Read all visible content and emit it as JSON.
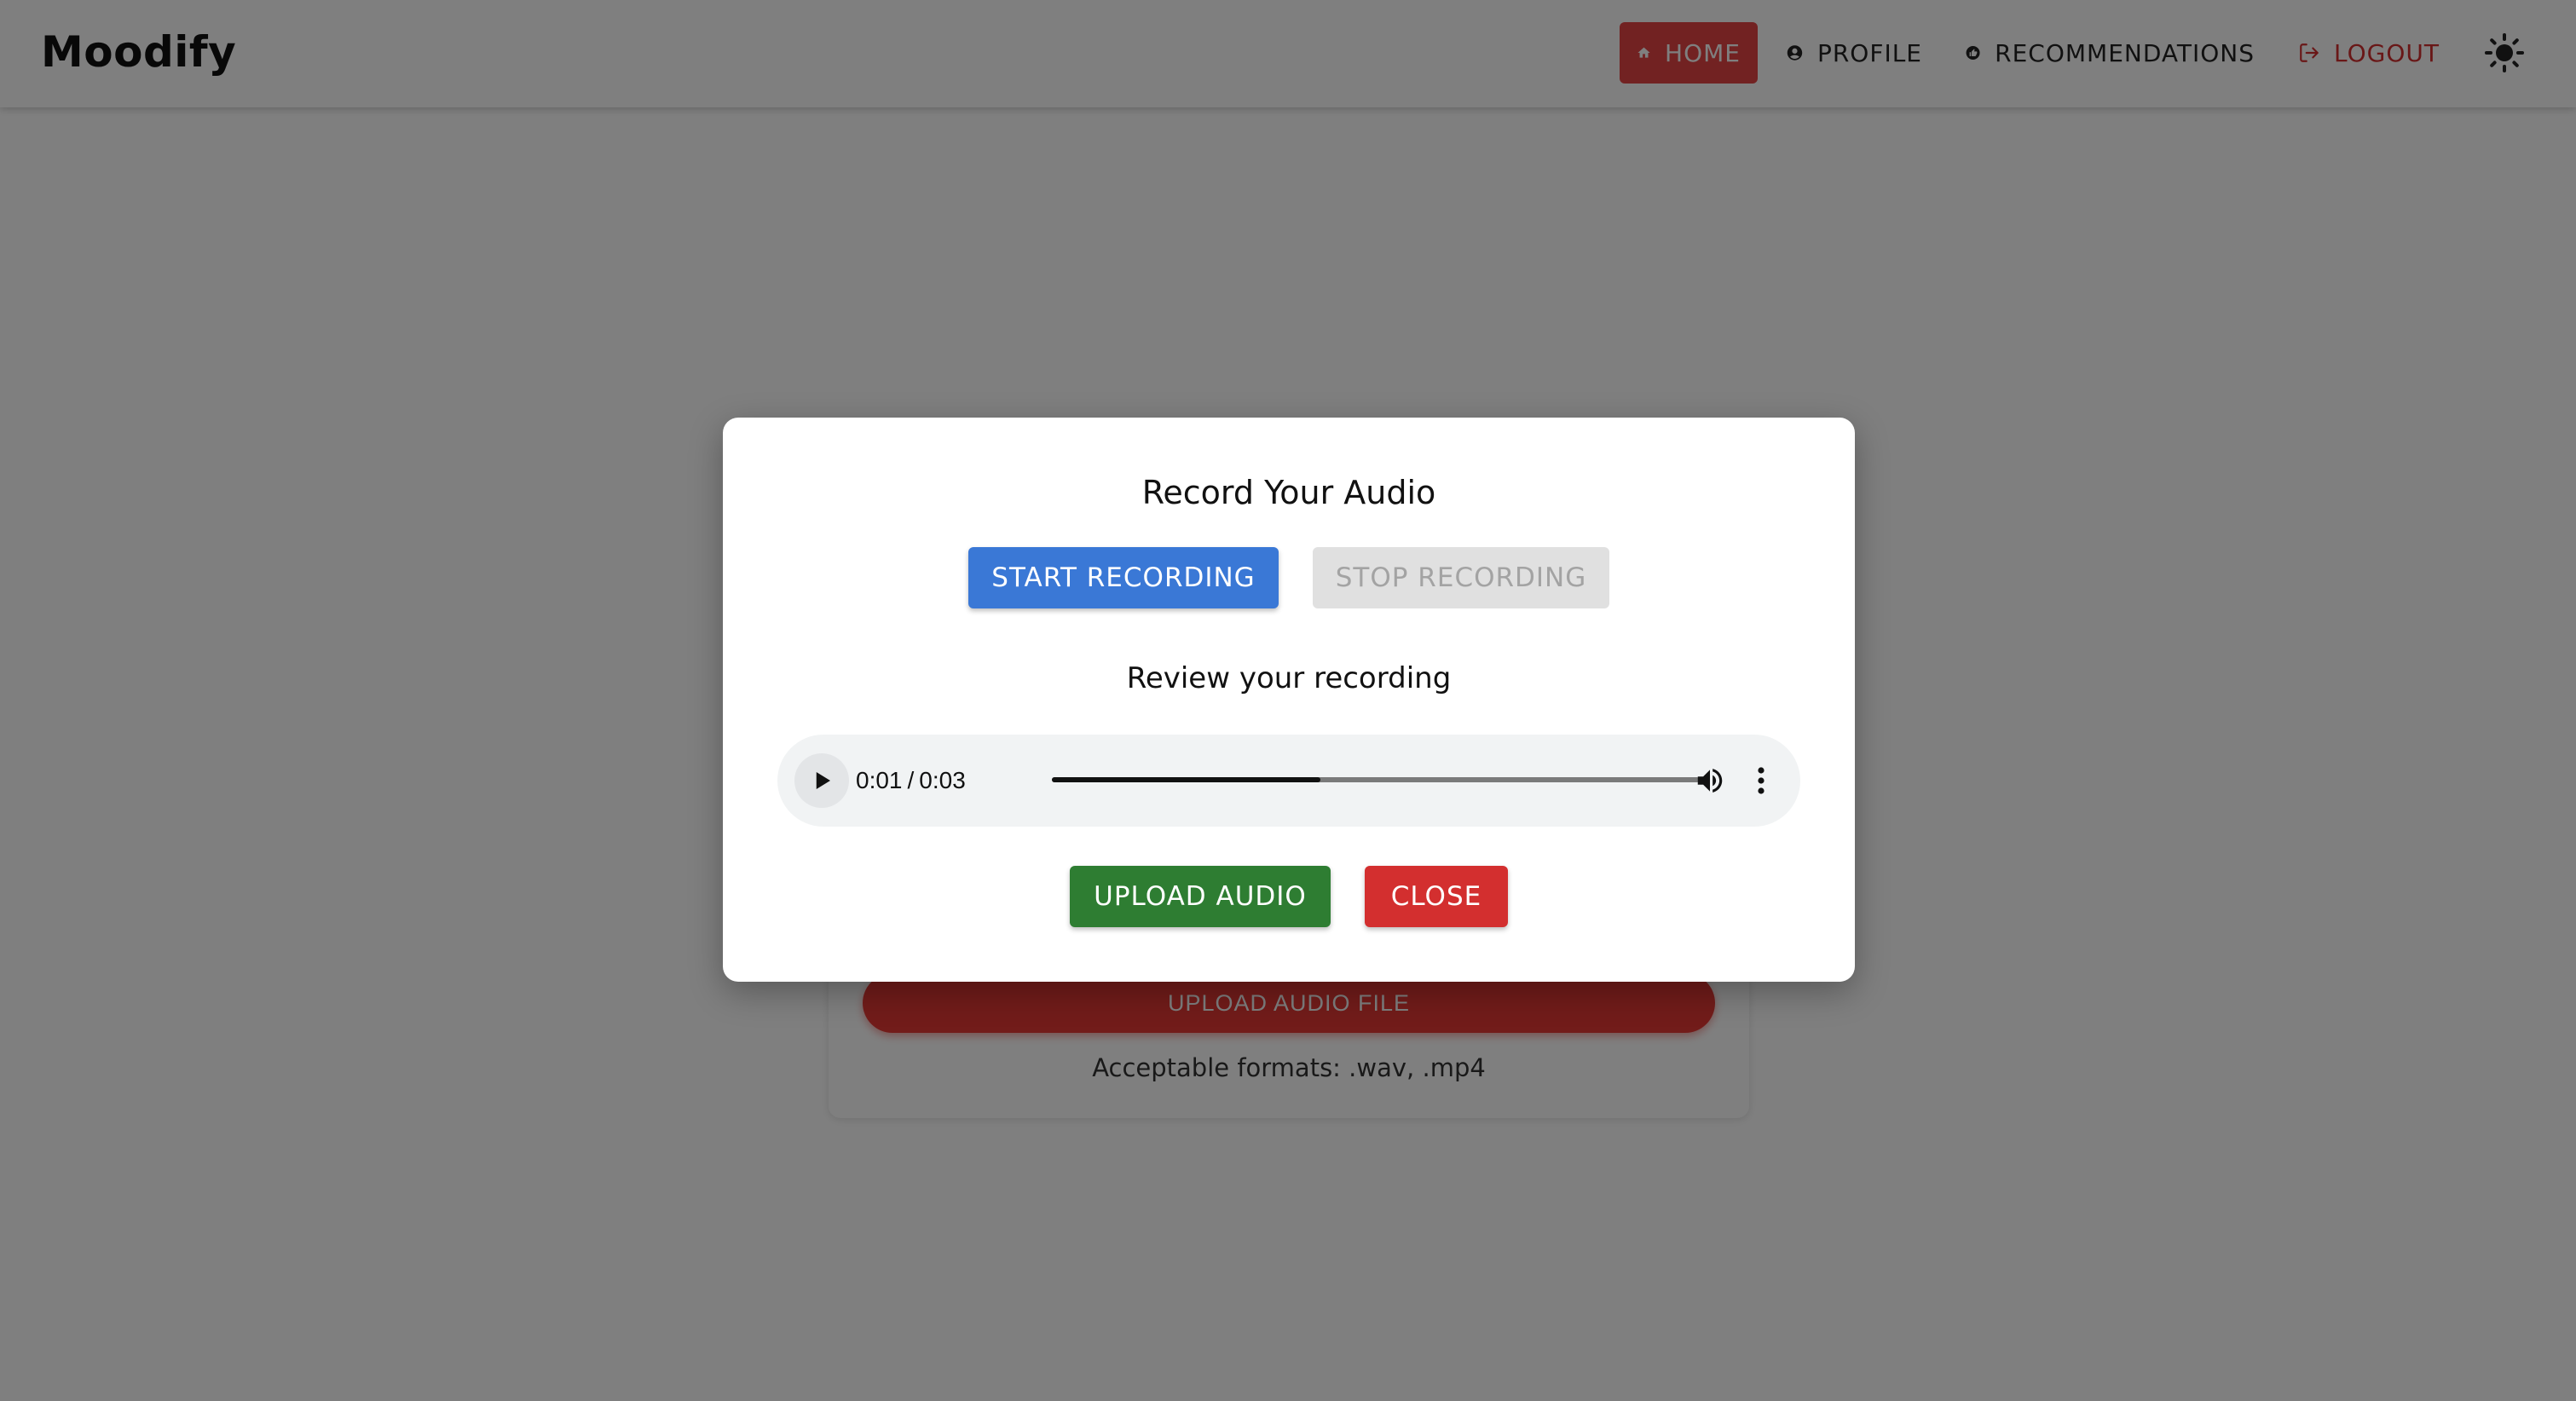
{
  "app": {
    "title": "Moodify"
  },
  "nav": {
    "items": [
      {
        "label": "HOME",
        "icon": "home-icon",
        "active": true
      },
      {
        "label": "PROFILE",
        "icon": "account-circle-icon"
      },
      {
        "label": "RECOMMENDATIONS",
        "icon": "thumb-up-icon"
      },
      {
        "label": "LOGOUT",
        "icon": "logout-icon"
      }
    ],
    "theme_toggle_icon": "sun-icon"
  },
  "background_card": {
    "upload_button_label": "UPLOAD AUDIO FILE",
    "formats_text": "Acceptable formats: .wav, .mp4"
  },
  "modal": {
    "title": "Record Your Audio",
    "start_label": "START RECORDING",
    "stop_label": "STOP RECORDING",
    "review_label": "Review your recording",
    "player": {
      "current_time": "0:01",
      "separator": "/",
      "duration": "0:03",
      "progress_fraction": 0.415,
      "play_icon": "play-icon",
      "volume_icon": "volume-icon",
      "more_icon": "more-vertical-icon"
    },
    "upload_label": "UPLOAD AUDIO",
    "close_label": "CLOSE"
  },
  "colors": {
    "accent_red": "#e54545",
    "logout_red": "#d32f2f",
    "start_blue": "#3a78d6",
    "upload_green": "#2e7d32",
    "close_red": "#d32f2f",
    "disabled_gray": "#e0e0e0"
  }
}
